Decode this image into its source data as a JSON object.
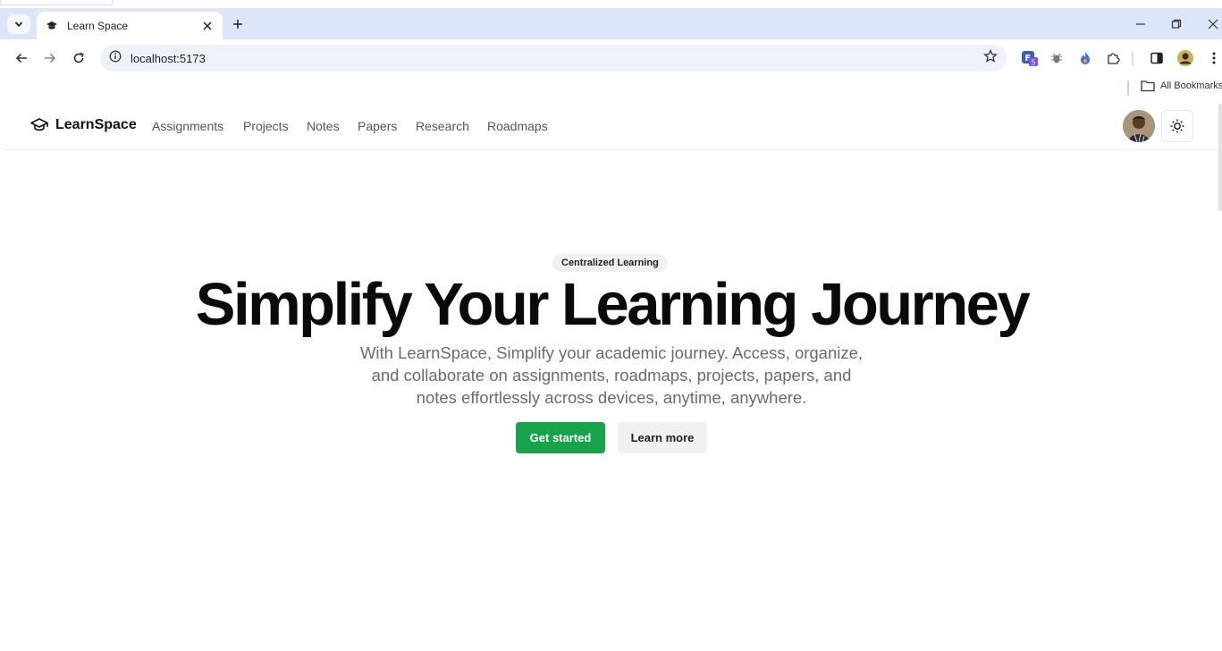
{
  "browser": {
    "tab_title": "Learn Space",
    "url": "localhost:5173",
    "bookmarks_label": "All Bookmarks",
    "accent_color": "#dde6f8"
  },
  "site": {
    "brand": "LearnSpace",
    "nav": [
      "Assignments",
      "Projects",
      "Notes",
      "Papers",
      "Research",
      "Roadmaps"
    ]
  },
  "hero": {
    "badge": "Centralized Learning",
    "title": "Simplify Your Learning Journey",
    "description_lines": [
      "With LearnSpace, Simplify your academic journey. Access, organize,",
      "and collaborate on assignments, roadmaps, projects, papers, and",
      "notes effortlessly across devices, anytime, anywhere."
    ],
    "primary_button": "Get started",
    "secondary_button": "Learn more",
    "primary_color": "#16a34a"
  }
}
